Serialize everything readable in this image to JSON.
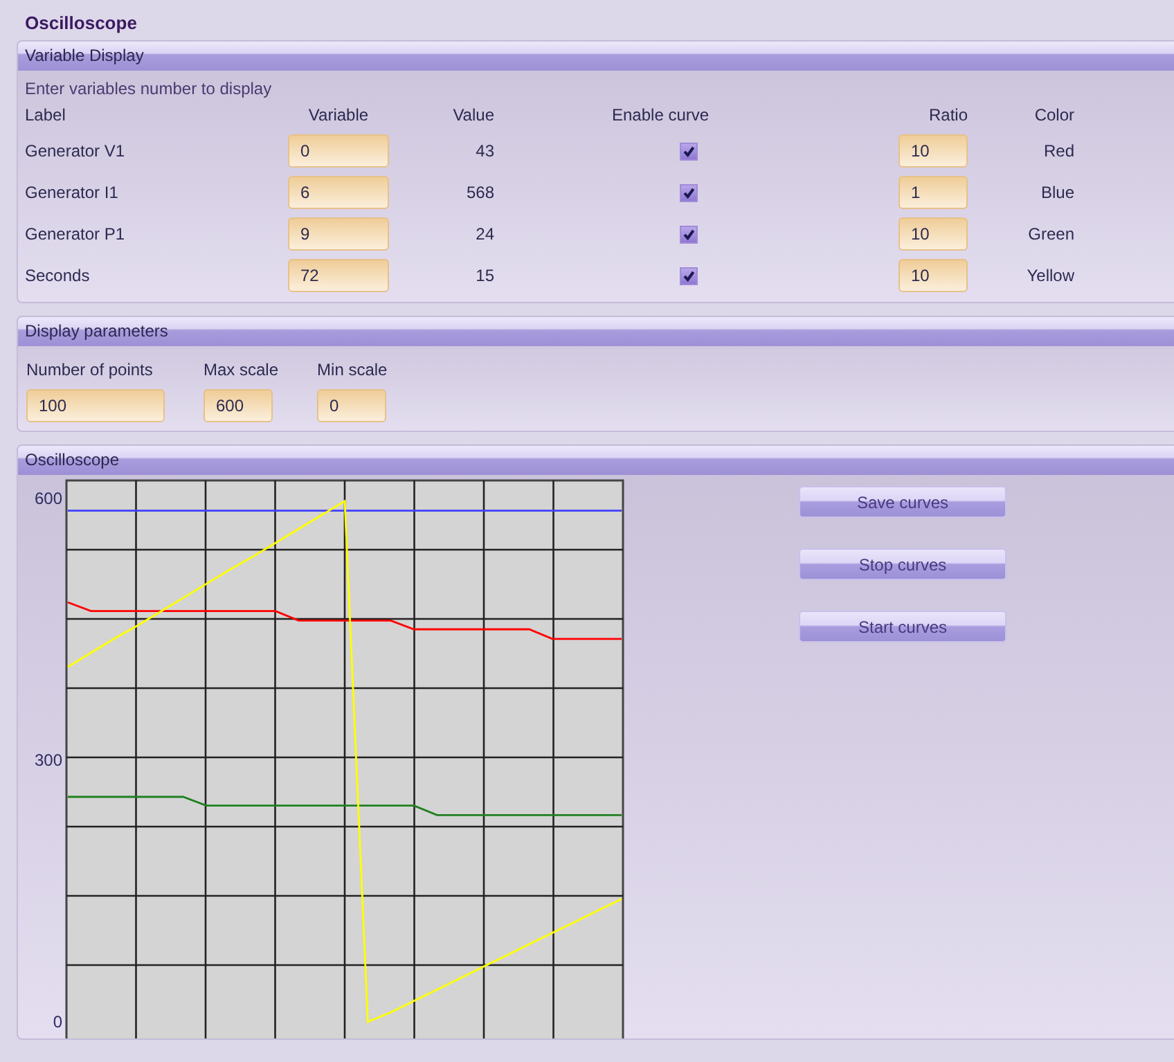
{
  "window": {
    "title": "Oscilloscope"
  },
  "variable_display": {
    "title": "Variable Display",
    "instruction": "Enter variables number to display",
    "columns": [
      "Label",
      "Variable",
      "Value",
      "Enable curve",
      "Ratio",
      "Color"
    ],
    "rows": [
      {
        "label": "Generator V1",
        "variable": "0",
        "value": "43",
        "enable_curve": true,
        "ratio": "10",
        "color_name": "Red"
      },
      {
        "label": "Generator I1",
        "variable": "6",
        "value": "568",
        "enable_curve": true,
        "ratio": "1",
        "color_name": "Blue"
      },
      {
        "label": "Generator P1",
        "variable": "9",
        "value": "24",
        "enable_curve": true,
        "ratio": "10",
        "color_name": "Green"
      },
      {
        "label": "Seconds",
        "variable": "72",
        "value": "15",
        "enable_curve": true,
        "ratio": "10",
        "color_name": "Yellow"
      }
    ]
  },
  "display_parameters": {
    "title": "Display parameters",
    "fields": [
      {
        "label": "Number of points",
        "value": "100"
      },
      {
        "label": "Max scale",
        "value": "600"
      },
      {
        "label": "Min scale",
        "value": "0"
      }
    ]
  },
  "oscilloscope": {
    "title": "Oscilloscope",
    "buttons": [
      "Save curves",
      "Stop curves",
      "Start curves"
    ],
    "chart_data": {
      "type": "line",
      "categories": [
        null,
        null,
        null,
        null,
        null,
        null,
        null,
        null,
        null,
        null,
        null,
        null,
        null,
        null,
        null,
        null,
        null,
        null,
        null,
        null,
        null,
        null,
        null,
        null,
        null
      ],
      "ylim": [
        -20.6,
        620.6
      ],
      "yticks": [
        0,
        300,
        600
      ],
      "grid": true,
      "series": [
        {
          "color": "#ff0000",
          "values": [
            481,
            471,
            471,
            471,
            471,
            471,
            471,
            471,
            471,
            471,
            460,
            460,
            460,
            460,
            460,
            450,
            450,
            450,
            450,
            450,
            450,
            439,
            439,
            439,
            439
          ]
        },
        {
          "color": "#4040ff",
          "values": [
            586,
            586,
            586,
            586,
            586,
            586,
            586,
            586,
            586,
            586,
            586,
            586,
            586,
            586,
            586,
            586,
            586,
            586,
            586,
            586,
            586,
            586,
            586,
            586,
            586
          ]
        },
        {
          "color": "#208020",
          "values": [
            258,
            258,
            258,
            258,
            258,
            258,
            248,
            248,
            248,
            248,
            248,
            248,
            248,
            248,
            248,
            248,
            237,
            237,
            237,
            237,
            237,
            237,
            237,
            237,
            237
          ]
        },
        {
          "color": "#ffff00",
          "values": [
            407,
            423,
            439,
            454,
            470,
            486,
            502,
            518,
            533,
            549,
            565,
            581,
            597,
            0,
            11,
            24,
            37,
            50,
            63,
            76,
            89,
            102,
            115,
            128,
            141
          ]
        }
      ]
    }
  }
}
